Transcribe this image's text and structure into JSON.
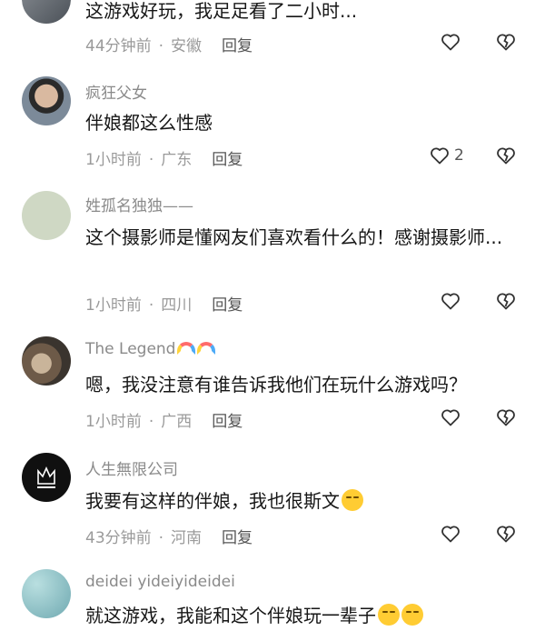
{
  "comments": [
    {
      "username": "",
      "text": "这游戏好玩，我足足看了二小时...",
      "time": "44分钟前",
      "location": "安徽",
      "reply": "回复",
      "likes": ""
    },
    {
      "username": "疯狂父女",
      "text": "伴娘都这么性感",
      "time": "1小时前",
      "location": "广东",
      "reply": "回复",
      "likes": "2"
    },
    {
      "username": "姓孤名独独——",
      "text": "这个摄影师是懂网友们喜欢看什么的！感谢摄影师...",
      "time": "1小时前",
      "location": "四川",
      "reply": "回复",
      "likes": ""
    },
    {
      "username": "The Legend",
      "text": "嗯，我没注意有谁告诉我他们在玩什么游戏吗？",
      "time": "1小时前",
      "location": "广西",
      "reply": "回复",
      "likes": ""
    },
    {
      "username": "人生無限公司",
      "text": "我要有这样的伴娘，我也很斯文",
      "time": "43分钟前",
      "location": "河南",
      "reply": "回复",
      "likes": ""
    },
    {
      "username": "deidei yideiyideidei",
      "text": "就这游戏，我能和这个伴娘玩一辈子",
      "time": "",
      "location": "",
      "reply": "",
      "likes": ""
    }
  ],
  "separator": "·",
  "icons": {
    "like": "heart-outline-icon",
    "dislike": "heart-broken-outline-icon"
  }
}
